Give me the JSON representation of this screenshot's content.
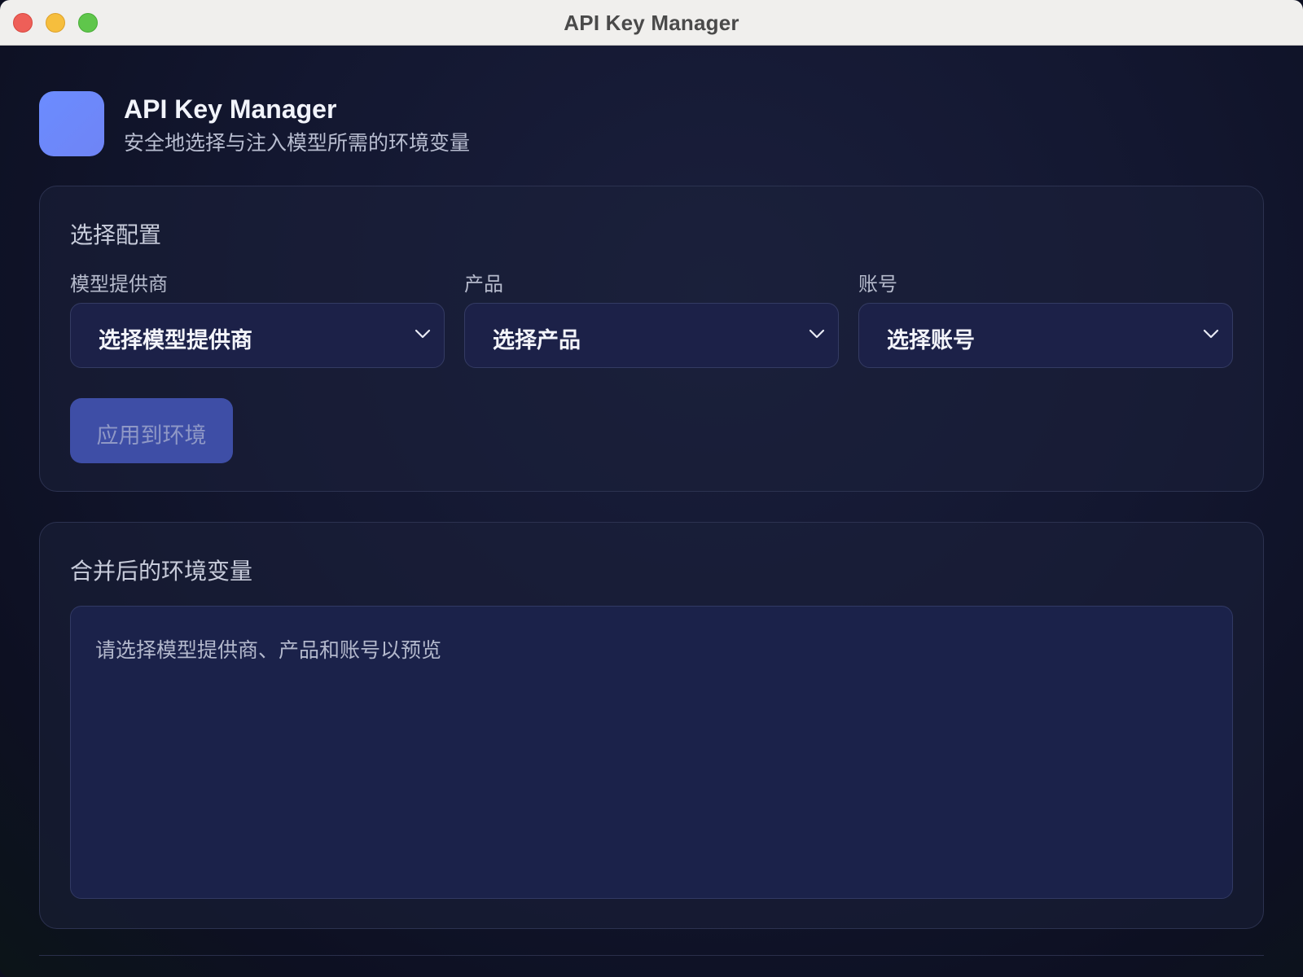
{
  "window": {
    "title": "API Key Manager"
  },
  "header": {
    "title": "API Key Manager",
    "subtitle": "安全地选择与注入模型所需的环境变量",
    "logo_color": "#6b8cff"
  },
  "config": {
    "section_title": "选择配置",
    "fields": [
      {
        "label": "模型提供商",
        "value": "选择模型提供商"
      },
      {
        "label": "产品",
        "value": "选择产品"
      },
      {
        "label": "账号",
        "value": "选择账号"
      }
    ],
    "apply_label": "应用到环境",
    "apply_disabled": true
  },
  "env": {
    "section_title": "合并后的环境变量",
    "placeholder": "请选择模型提供商、产品和账号以预览"
  },
  "colors": {
    "accent": "#6b8cff",
    "button_disabled": "#3e4ea6",
    "background": "#131730"
  },
  "icons": {
    "dropdown": "chevron-down-icon"
  }
}
